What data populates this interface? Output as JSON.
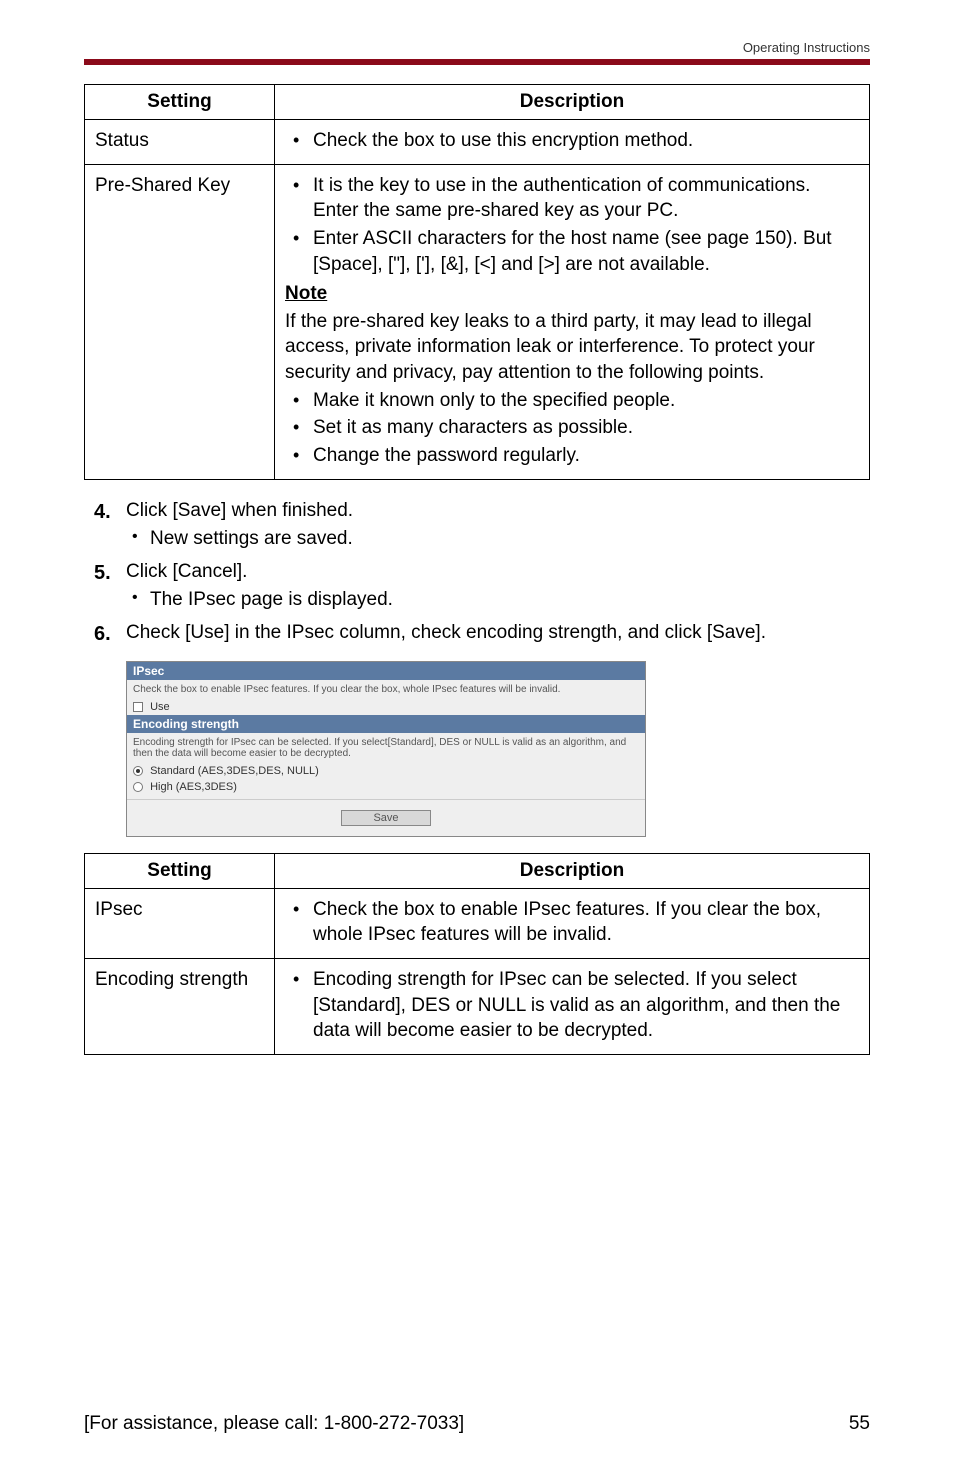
{
  "header": {
    "breadcrumb": "Operating Instructions"
  },
  "table1": {
    "headers": {
      "setting": "Setting",
      "description": "Description"
    },
    "rows": [
      {
        "setting": "Status",
        "bullets": [
          "Check the box to use this encryption method."
        ]
      },
      {
        "setting": "Pre-Shared Key",
        "bullets_top": [
          "It is the key to use in the authentication of communications. Enter the same pre-shared key as your PC.",
          "Enter ASCII characters for the host name (see page 150). But [Space], [\"], ['], [&], [<] and [>] are not available."
        ],
        "note_label": "Note",
        "note_para": "If the pre-shared key leaks to a third party, it may lead to illegal access, private information leak or interference. To protect your security and privacy, pay attention to the following points.",
        "bullets_bottom": [
          "Make it known only to the specified people.",
          "Set it as many characters as possible.",
          "Change the password regularly."
        ]
      }
    ]
  },
  "steps": [
    {
      "num": "4.",
      "text": "Click [Save] when finished.",
      "sub": [
        "New settings are saved."
      ]
    },
    {
      "num": "5.",
      "text": "Click [Cancel].",
      "sub": [
        "The IPsec page is displayed."
      ]
    },
    {
      "num": "6.",
      "text": "Check [Use] in the IPsec column, check encoding strength, and click [Save]."
    }
  ],
  "screenshot": {
    "ipsec_title": "IPsec",
    "ipsec_desc": "Check the box to enable IPsec features. If you clear the box, whole IPsec features will be invalid.",
    "use_label": "Use",
    "enc_title": "Encoding strength",
    "enc_desc": "Encoding strength for IPsec can be selected. If you select[Standard], DES or NULL is valid as an algorithm, and then the data will become easier to be decrypted.",
    "opt_standard": "Standard (AES,3DES,DES, NULL)",
    "opt_high": "High (AES,3DES)",
    "save": "Save"
  },
  "table2": {
    "headers": {
      "setting": "Setting",
      "description": "Description"
    },
    "rows": [
      {
        "setting": "IPsec",
        "bullets": [
          "Check the box to enable IPsec features. If you clear the box, whole IPsec features will be invalid."
        ]
      },
      {
        "setting": "Encoding strength",
        "bullets": [
          "Encoding strength for IPsec can be selected. If you select [Standard], DES or NULL is valid as an algorithm, and then the data will become easier to be decrypted."
        ]
      }
    ]
  },
  "footer": {
    "assist": "[For assistance, please call: 1-800-272-7033]",
    "page": "55"
  }
}
